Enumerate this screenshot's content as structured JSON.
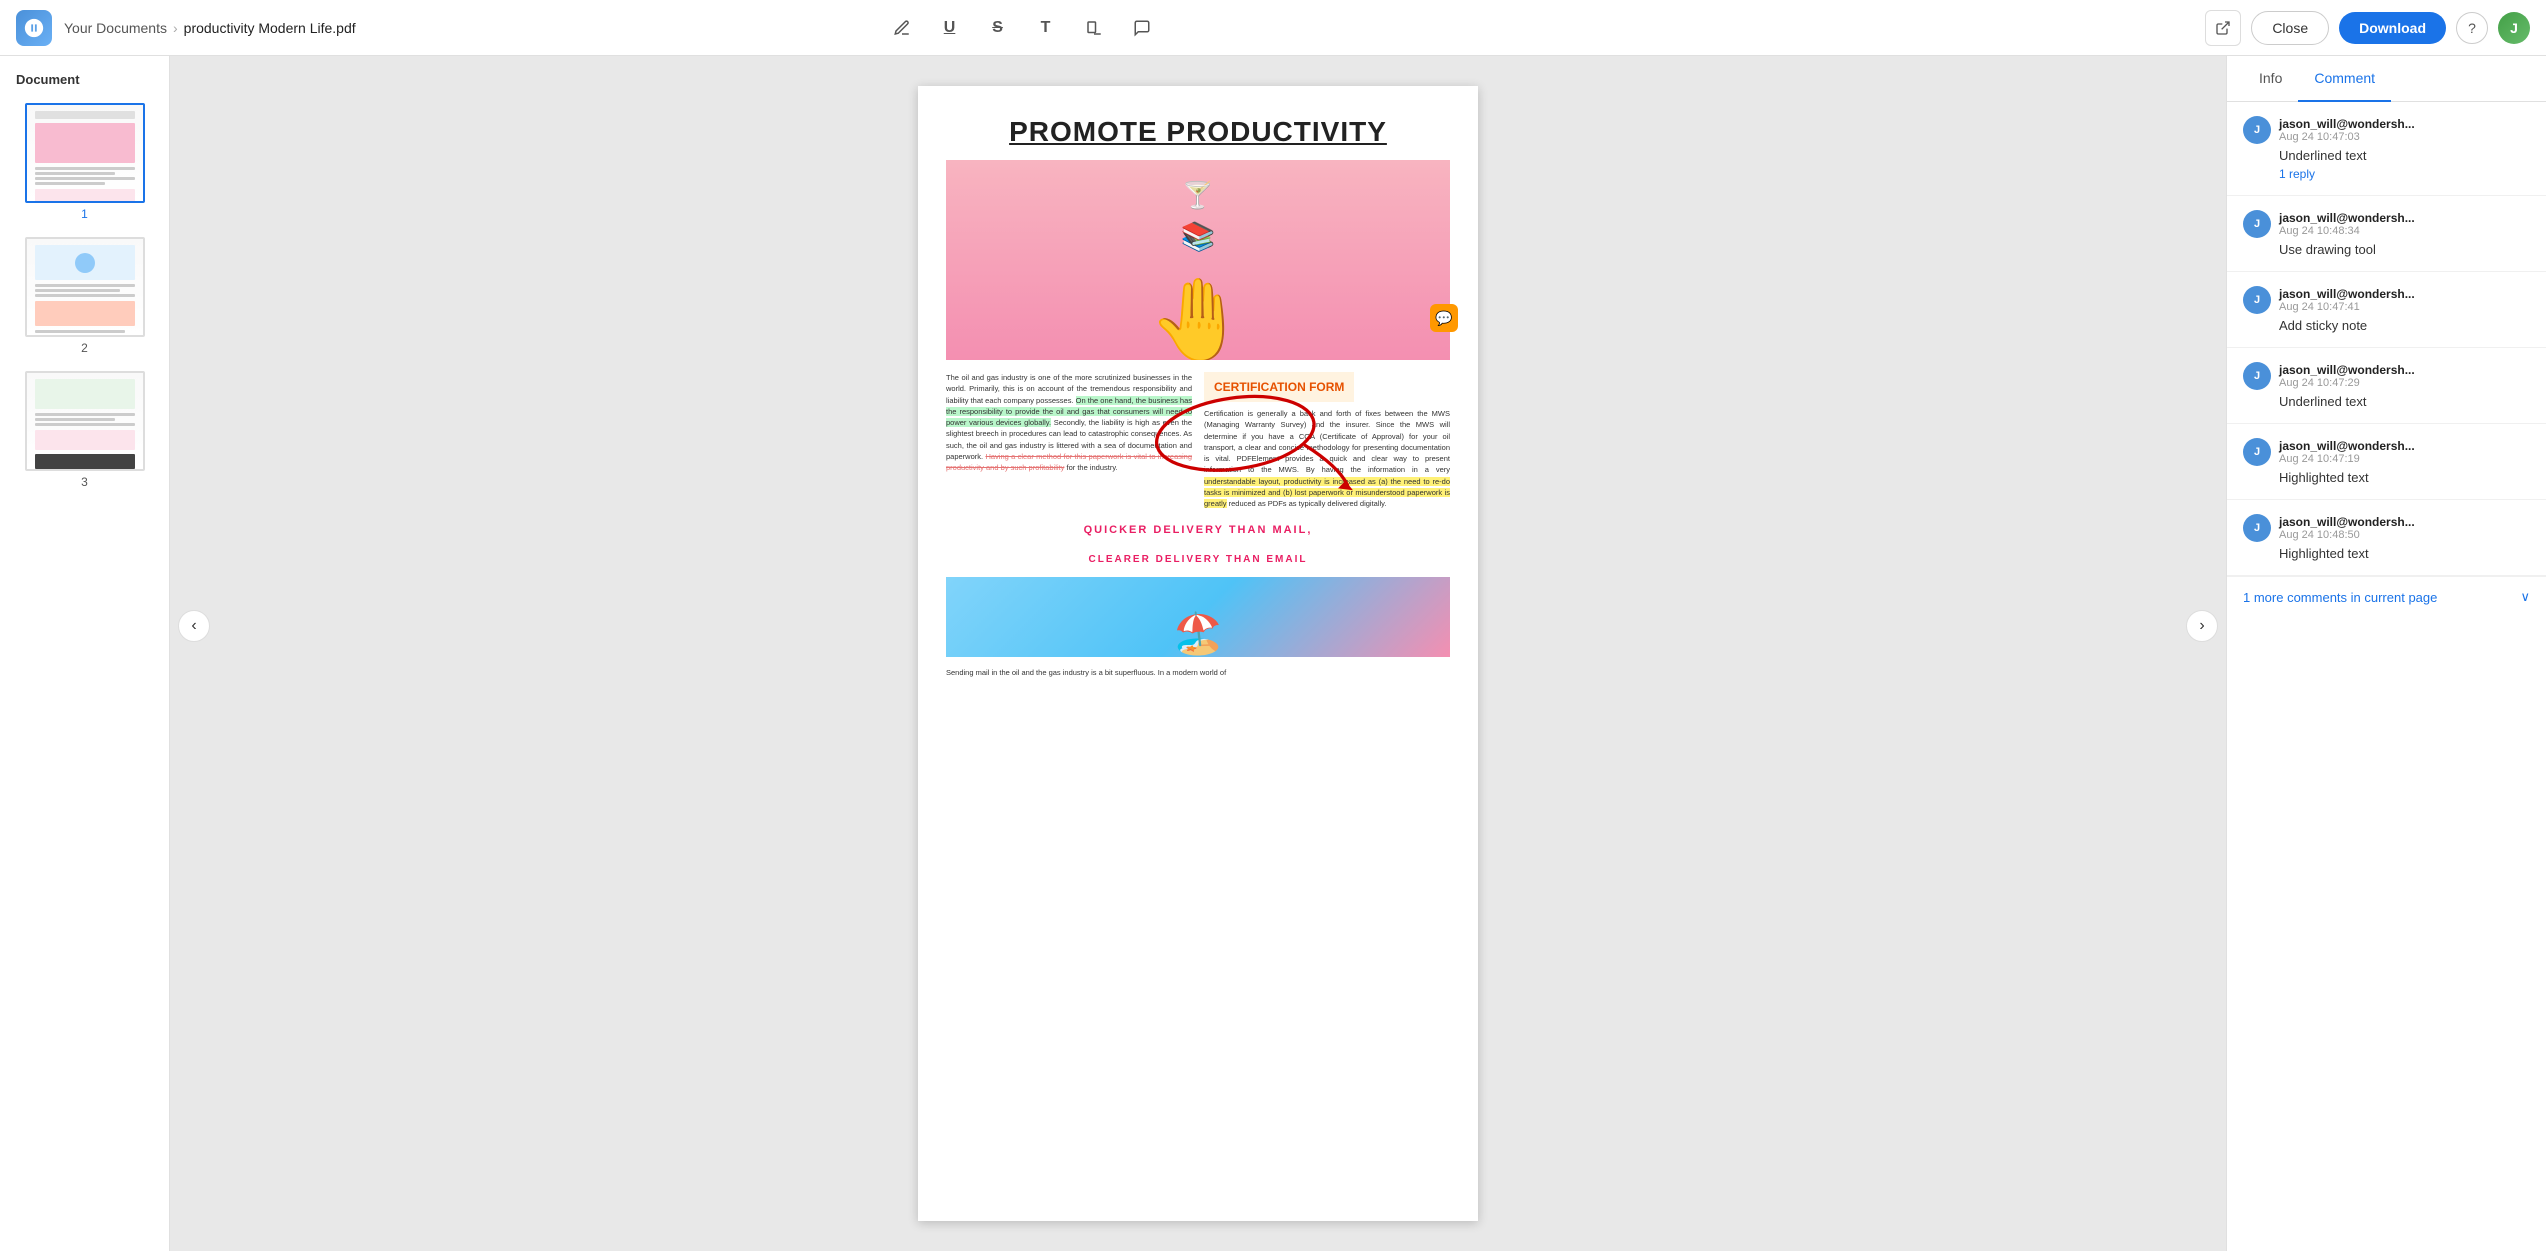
{
  "topbar": {
    "logo_alt": "App Logo",
    "breadcrumb_parent": "Your Documents",
    "breadcrumb_current": "productivity Modern Life.pdf",
    "tools": [
      {
        "name": "pen-tool",
        "icon": "✏️",
        "label": "Pen"
      },
      {
        "name": "underline-tool",
        "icon": "U̲",
        "label": "Underline"
      },
      {
        "name": "strikethrough-tool",
        "icon": "S̶",
        "label": "Strikethrough"
      },
      {
        "name": "text-tool",
        "icon": "T",
        "label": "Text"
      },
      {
        "name": "highlight-tool",
        "icon": "🖊",
        "label": "Highlight"
      },
      {
        "name": "comment-tool",
        "icon": "💬",
        "label": "Comment"
      }
    ],
    "external_link_label": "Open in new tab",
    "close_label": "Close",
    "download_label": "Download",
    "help_label": "?",
    "avatar_label": "J"
  },
  "sidebar": {
    "header": "Document",
    "pages": [
      {
        "num": "1",
        "active": true
      },
      {
        "num": "2",
        "active": false
      },
      {
        "num": "3",
        "active": false
      }
    ]
  },
  "nav": {
    "left": "‹",
    "right": "›"
  },
  "page": {
    "title": "PROMOTE PRODUCTIVITY",
    "cert_header": "CERTIFICATION FORM",
    "left_col_text": "The oil and gas industry is one of the more scrutinized businesses in the world. Primarily, this is on account of the tremendous responsibility and liability that each company possesses.",
    "left_col_highlighted": "On the one hand, the business has the responsibility to provide the oil and gas that consumers will need to power various devices globally.",
    "left_col_normal": "Secondly, the liability is high as even the slightest breech in procedures can lead to catastrophic consequences. As such, the oil and gas industry is littered with a sea of documentation and paperwork.",
    "left_col_strike": "Having a clear method for this paperwork is vital to increasing productivity and by such profitability",
    "left_col_end": "for the industry.",
    "right_col_cert": "Certification is generally a back and forth of fixes between the MWS (Managing Warranty Survey) and the insurer. Since the MWS will determine if you have a COA (Certificate of Approval) for your oil transport, a clear and concise methodology for presenting documentation is vital. PDFElement provides a quick and clear way to present information to the MWS. By having the information in a very",
    "right_col_highlighted_yellow": "understandable layout, productivity is increased as (a) the need to re-do tasks is minimized and (b) lost paperwork or misunderstood paperwork is greatly",
    "right_col_end": "reduced as PDFs as typically delivered digitally.",
    "quicker_line1": "QUICKER   DELIVERY   THAN   MAIL,",
    "quicker_line2": "CLEARER DELIVERY THAN EMAIL",
    "sending_text": "Sending mail in the oil and the gas industry is a bit superfluous. In a modern world of"
  },
  "right_panel": {
    "tabs": [
      {
        "label": "Info",
        "active": false
      },
      {
        "label": "Comment",
        "active": true
      }
    ],
    "comments": [
      {
        "id": "c1",
        "user": "jason_will@wondersh...",
        "time": "Aug 24 10:47:03",
        "text": "Underlined text",
        "reply": "1 reply",
        "avatar": "J"
      },
      {
        "id": "c2",
        "user": "jason_will@wondersh...",
        "time": "Aug 24 10:48:34",
        "text": "Use drawing tool",
        "reply": "",
        "avatar": "J"
      },
      {
        "id": "c3",
        "user": "jason_will@wondersh...",
        "time": "Aug 24 10:47:41",
        "text": "Add sticky note",
        "reply": "",
        "avatar": "J"
      },
      {
        "id": "c4",
        "user": "jason_will@wondersh...",
        "time": "Aug 24 10:47:29",
        "text": "Underlined text",
        "reply": "",
        "avatar": "J"
      },
      {
        "id": "c5",
        "user": "jason_will@wondersh...",
        "time": "Aug 24 10:47:19",
        "text": "Highlighted text",
        "reply": "",
        "avatar": "J"
      },
      {
        "id": "c6",
        "user": "jason_will@wondersh...",
        "time": "Aug 24 10:48:50",
        "text": "Highlighted text",
        "reply": "",
        "avatar": "J"
      }
    ],
    "more_comments": "1 more comments in current page"
  }
}
